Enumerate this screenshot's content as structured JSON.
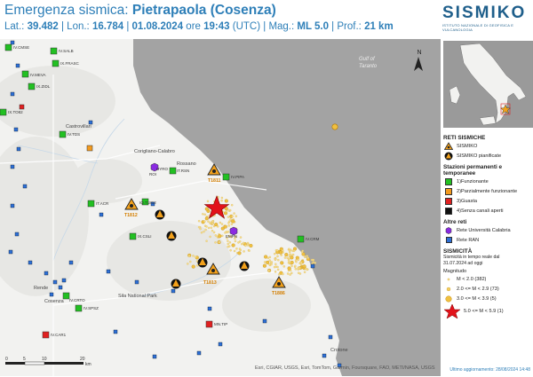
{
  "header": {
    "prefix": "Emergenza sismica:",
    "place": "Pietrapaola (Cosenza)",
    "lat_label": "Lat.:",
    "lat": "39.482",
    "lon_label": "Lon.:",
    "lon": "16.784",
    "date": "01.08.2024",
    "time_label": "ore",
    "time": "19:43",
    "tz": "(UTC)",
    "mag_label": "Mag.:",
    "mag": "ML 5.0",
    "depth_label": "Prof.:",
    "depth": "21 km"
  },
  "logo": {
    "name": "SISMIKO",
    "subtitle": "ISTITUTO NAZIONALE DI GEOFISICA E VULCANOLOGIA"
  },
  "map": {
    "sea_label_1": "Gulf of",
    "sea_label_2": "Taranto",
    "places": [
      "Corigliano-Calabro",
      "Rossano",
      "Sila National Park",
      "Crotone",
      "Cosenza",
      "Rende",
      "Castrovillari"
    ],
    "north_label": "N",
    "attribution": "Esri, CGIAR, USGS, Esri, TomTom, Garmin, Foursquare, FAO, METI/NASA, USGS",
    "scale_ticks": [
      "0",
      "5",
      "10",
      "20"
    ],
    "scale_unit": "km",
    "stations": [
      {
        "code": "IV.CMSE",
        "color": "#22c022"
      },
      {
        "code": "IV.SALB",
        "color": "#22c022"
      },
      {
        "code": "IX.FRASC",
        "color": "#22c022"
      },
      {
        "code": "IV.MEVA",
        "color": "#22c022"
      },
      {
        "code": "IX.ZIDL",
        "color": "#22c022"
      },
      {
        "code": "IX.TO82",
        "color": "#22c022"
      },
      {
        "code": "IV.TDS",
        "color": "#22c022"
      },
      {
        "code": "IV.PIA",
        "color": "#22c022"
      },
      {
        "code": "ROI",
        "color": "#22c022"
      },
      {
        "code": "IT.RSN",
        "color": "#22c022"
      },
      {
        "code": "IT.ACR",
        "color": "#22c022"
      },
      {
        "code": "IQ.T1812",
        "color": "#22c022"
      },
      {
        "code": "IV.PIPA",
        "color": "#22c022"
      },
      {
        "code": "IX.CSLI",
        "color": "#22c022"
      },
      {
        "code": "IV.CRM",
        "color": "#22c022"
      },
      {
        "code": "IV.CRTO",
        "color": "#22c022"
      },
      {
        "code": "IV.SPSZ",
        "color": "#22c022"
      },
      {
        "code": "IV.CAR1",
        "color": "#e02020"
      },
      {
        "code": "MN.TIP",
        "color": "#e02020"
      }
    ],
    "sismiko_stations": [
      {
        "code": "T1811",
        "planned": false
      },
      {
        "code": "T1812",
        "planned": false
      },
      {
        "code": "T1813",
        "planned": false
      },
      {
        "code": "T1886",
        "planned": false
      }
    ],
    "university_stations": [
      "HYRO",
      "EMPN"
    ]
  },
  "legend": {
    "networks_title": "RETI SISMICHE",
    "sismiko": "SISMIKO",
    "sismiko_planned": "SISMIKO pianificate",
    "stations_title": "Stazioni permanenti e temporanee",
    "status": [
      {
        "label": "1)Funzionante",
        "color": "#22c022"
      },
      {
        "label": "2)Parzialmente funzionante",
        "color": "#f39a1e"
      },
      {
        "label": "3)Guasta",
        "color": "#e02020"
      },
      {
        "label": "4)Senza canali aperti",
        "color": "#111111"
      }
    ],
    "other_title": "Altre reti",
    "uni_calabria": "Rete Università Calabria",
    "ran": "Rete RAN",
    "seismicity_title": "SISMICITÀ",
    "seismicity_sub": "Sismicità in tempo reale dal 31.07.2024 ad oggi",
    "magnitude_title": "Magnitudo",
    "mag_classes": [
      {
        "label": "M < 2.0 (382)"
      },
      {
        "label": "2.0 <= M < 2.9 (73)"
      },
      {
        "label": "3.0 <= M < 3.9 (5)"
      },
      {
        "label": "5.0 <= M < 5.9 (1)"
      }
    ],
    "updated": "Ultimo aggiornamento: 28/08/2024 14:48"
  },
  "colors": {
    "title_blue": "#2e7fb8",
    "sea": "#a3a3a3",
    "land": "#f2f2f0",
    "event_small": "#f7dd8a",
    "event_mid": "#f0c040",
    "mainshock": "#e2121a"
  }
}
